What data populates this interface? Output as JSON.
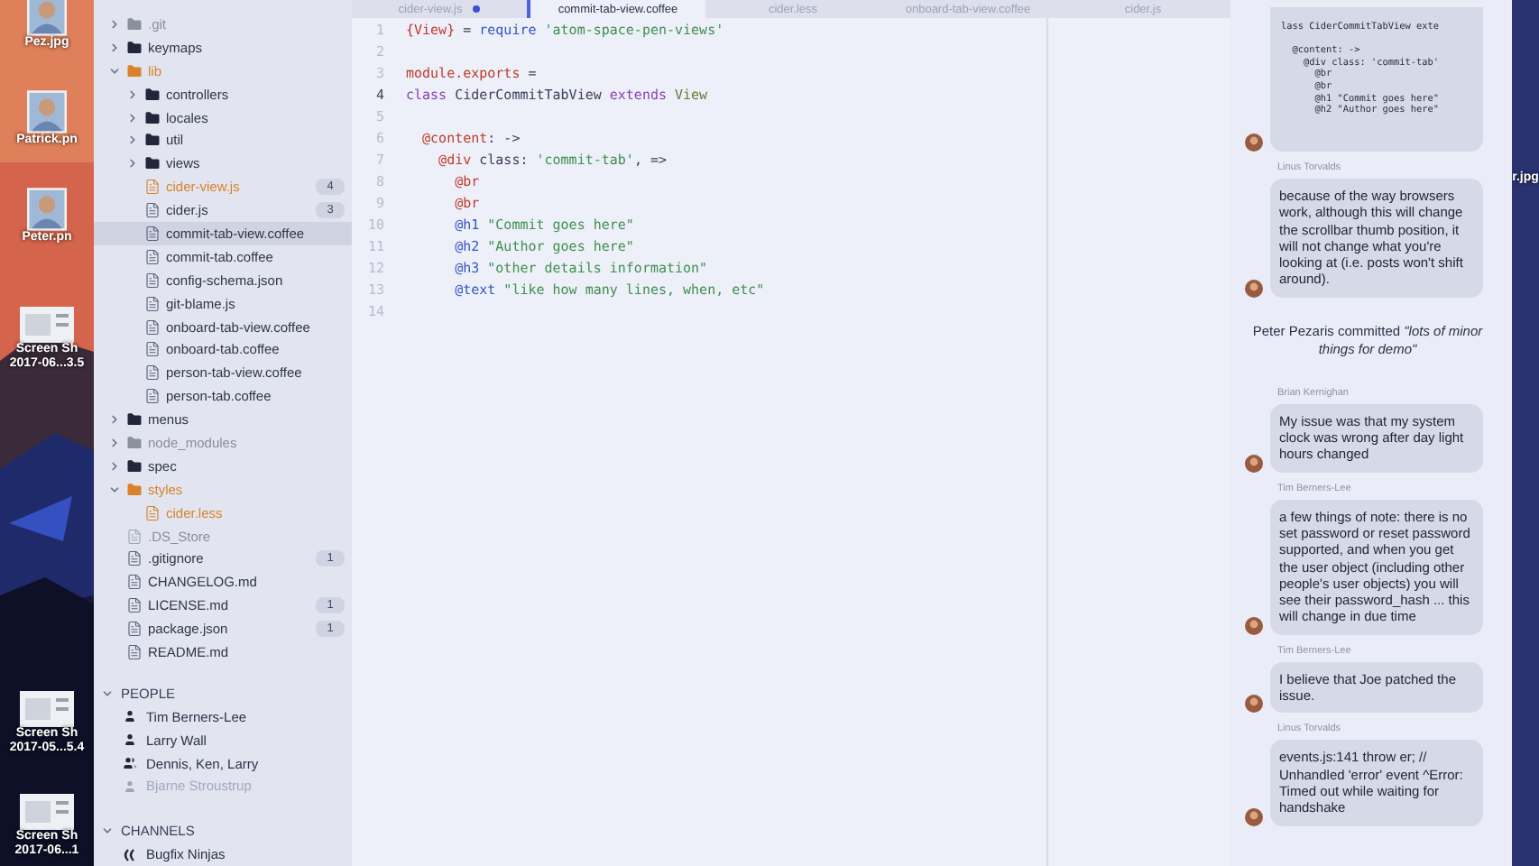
{
  "desktop_left": [
    {
      "lines": [
        "Pez.jpg"
      ]
    },
    {
      "lines": [
        "Patrick.pn"
      ]
    },
    {
      "lines": [
        "Peter.pn"
      ]
    },
    {
      "kind": "screenshot",
      "lines": [
        "Screen Sh",
        "2017-06...3.5"
      ]
    },
    {
      "kind": "screenshot",
      "lines": [
        "Screen Sh",
        "2017-05...5.4"
      ]
    },
    {
      "kind": "screenshot",
      "lines": [
        "Screen Sh",
        "2017-06...1"
      ]
    }
  ],
  "desktop_right": {
    "label": "r.jpg"
  },
  "tree": [
    {
      "name": ".git",
      "kind": "folder",
      "expanded": false,
      "modified": false,
      "ignored": true,
      "selected": false
    },
    {
      "name": "keymaps",
      "kind": "folder",
      "expanded": false,
      "modified": false,
      "ignored": false,
      "selected": false
    },
    {
      "name": "lib",
      "kind": "folder",
      "expanded": true,
      "modified": true,
      "ignored": false,
      "selected": false,
      "children": [
        {
          "name": "controllers",
          "kind": "folder",
          "expanded": false,
          "modified": false,
          "ignored": false,
          "selected": false
        },
        {
          "name": "locales",
          "kind": "folder",
          "expanded": false,
          "modified": false,
          "ignored": false,
          "selected": false
        },
        {
          "name": "util",
          "kind": "folder",
          "expanded": false,
          "modified": false,
          "ignored": false,
          "selected": false
        },
        {
          "name": "views",
          "kind": "folder",
          "expanded": false,
          "modified": false,
          "ignored": false,
          "selected": false
        },
        {
          "name": "cider-view.js",
          "kind": "file",
          "modified": true,
          "ignored": false,
          "badge": "4",
          "selected": false
        },
        {
          "name": "cider.js",
          "kind": "file",
          "modified": false,
          "ignored": false,
          "badge": "3",
          "selected": false
        },
        {
          "name": "commit-tab-view.coffee",
          "kind": "file",
          "modified": false,
          "ignored": false,
          "selected": true
        },
        {
          "name": "commit-tab.coffee",
          "kind": "file",
          "modified": false,
          "ignored": false,
          "selected": false
        },
        {
          "name": "config-schema.json",
          "kind": "file",
          "modified": false,
          "ignored": false,
          "selected": false
        },
        {
          "name": "git-blame.js",
          "kind": "file",
          "modified": false,
          "ignored": false,
          "selected": false
        },
        {
          "name": "onboard-tab-view.coffee",
          "kind": "file",
          "modified": false,
          "ignored": false,
          "selected": false
        },
        {
          "name": "onboard-tab.coffee",
          "kind": "file",
          "modified": false,
          "ignored": false,
          "selected": false
        },
        {
          "name": "person-tab-view.coffee",
          "kind": "file",
          "modified": false,
          "ignored": false,
          "selected": false
        },
        {
          "name": "person-tab.coffee",
          "kind": "file",
          "modified": false,
          "ignored": false,
          "selected": false
        }
      ]
    },
    {
      "name": "menus",
      "kind": "folder",
      "expanded": false,
      "modified": false,
      "ignored": false,
      "selected": false
    },
    {
      "name": "node_modules",
      "kind": "folder",
      "expanded": false,
      "modified": false,
      "ignored": true,
      "selected": false
    },
    {
      "name": "spec",
      "kind": "folder",
      "expanded": false,
      "modified": false,
      "ignored": false,
      "selected": false
    },
    {
      "name": "styles",
      "kind": "folder",
      "expanded": true,
      "modified": true,
      "ignored": false,
      "selected": false,
      "children": [
        {
          "name": "cider.less",
          "kind": "file",
          "modified": true,
          "ignored": false,
          "selected": false
        }
      ]
    },
    {
      "name": ".DS_Store",
      "kind": "file",
      "modified": false,
      "ignored": true,
      "selected": false
    },
    {
      "name": ".gitignore",
      "kind": "file",
      "modified": false,
      "ignored": false,
      "badge": "1",
      "selected": false
    },
    {
      "name": "CHANGELOG.md",
      "kind": "file",
      "modified": false,
      "ignored": false,
      "selected": false
    },
    {
      "name": "LICENSE.md",
      "kind": "file",
      "modified": false,
      "ignored": false,
      "badge": "1",
      "selected": false
    },
    {
      "name": "package.json",
      "kind": "file",
      "modified": false,
      "ignored": false,
      "badge": "1",
      "selected": false
    },
    {
      "name": "README.md",
      "kind": "file",
      "modified": false,
      "ignored": false,
      "selected": false
    }
  ],
  "people": {
    "title": "PEOPLE",
    "expanded": true,
    "items": [
      {
        "name": "Tim Berners-Lee",
        "kind": "person",
        "online": true
      },
      {
        "name": "Larry Wall",
        "kind": "person",
        "online": true
      },
      {
        "name": "Dennis, Ken, Larry",
        "kind": "group",
        "online": true
      },
      {
        "name": "Bjarne Stroustrup",
        "kind": "person",
        "online": false
      }
    ]
  },
  "channels": {
    "title": "CHANNELS",
    "expanded": true,
    "items": [
      {
        "name": "Bugfix Ninjas"
      }
    ]
  },
  "tabs": [
    {
      "label": "cider-view.js",
      "selected": false,
      "modified": true
    },
    {
      "label": "commit-tab-view.coffee",
      "selected": true,
      "modified": false
    },
    {
      "label": "cider.less",
      "selected": false,
      "modified": false
    },
    {
      "label": "onboard-tab-view.coffee",
      "selected": false,
      "modified": false
    },
    {
      "label": "cider.js",
      "selected": false,
      "modified": false
    }
  ],
  "code": [
    {
      "number": "1",
      "current": false,
      "tokens": [
        {
          "text": "{View}",
          "kind": "variable"
        },
        {
          "text": " = ",
          "kind": "plain"
        },
        {
          "text": "require",
          "kind": "builtin"
        },
        {
          "text": " 'atom-space-pen-views'",
          "kind": "string"
        }
      ]
    },
    {
      "number": "2",
      "current": false
    },
    {
      "number": "3",
      "current": false,
      "tokens": [
        {
          "text": "module.exports",
          "kind": "variable"
        },
        {
          "text": " =",
          "kind": "plain"
        }
      ]
    },
    {
      "number": "4",
      "current": true,
      "tokens": [
        {
          "text": "class",
          "kind": "keyword"
        },
        {
          "text": " CiderCommitTabView ",
          "kind": "plain"
        },
        {
          "text": "extends",
          "kind": "keyword"
        },
        {
          "text": " View",
          "kind": "class"
        }
      ]
    },
    {
      "number": "5",
      "current": false
    },
    {
      "number": "6",
      "current": false,
      "tokens": [
        {
          "text": "  @content",
          "kind": "variable"
        },
        {
          "text": ": ->",
          "kind": "plain"
        }
      ]
    },
    {
      "number": "7",
      "current": false,
      "tokens": [
        {
          "text": "    @div",
          "kind": "variable"
        },
        {
          "text": " class: ",
          "kind": "plain"
        },
        {
          "text": "'commit-tab'",
          "kind": "string"
        },
        {
          "text": ", =>",
          "kind": "plain"
        }
      ]
    },
    {
      "number": "8",
      "current": false,
      "tokens": [
        {
          "text": "      @br",
          "kind": "variable"
        }
      ]
    },
    {
      "number": "9",
      "current": false,
      "tokens": [
        {
          "text": "      @br",
          "kind": "variable"
        }
      ]
    },
    {
      "number": "10",
      "current": false,
      "tokens": [
        {
          "text": "      @h1",
          "kind": "builtin"
        },
        {
          "text": " \"Commit goes here\"",
          "kind": "string"
        }
      ]
    },
    {
      "number": "11",
      "current": false,
      "tokens": [
        {
          "text": "      @h2",
          "kind": "builtin"
        },
        {
          "text": " \"Author goes here\"",
          "kind": "string"
        }
      ]
    },
    {
      "number": "12",
      "current": false,
      "tokens": [
        {
          "text": "      @h3",
          "kind": "builtin"
        },
        {
          "text": " \"other details information\"",
          "kind": "string"
        }
      ]
    },
    {
      "number": "13",
      "current": false,
      "tokens": [
        {
          "text": "      @text",
          "kind": "builtin"
        },
        {
          "text": " \"like how many lines, when, etc\"",
          "kind": "string"
        }
      ]
    },
    {
      "number": "14",
      "current": false
    }
  ],
  "chat": [
    {
      "kind": "code",
      "lines": [
        "lass CiderCommitTabView exte",
        "  @content: ->",
        "    @div class: 'commit-tab'",
        "      @br",
        "      @br",
        "      @h1 \"Commit goes here\"",
        "      @h2 \"Author goes here\""
      ]
    },
    {
      "kind": "message",
      "author": "Linus Torvalds",
      "text": "because of the way browsers work, although this will change the scrollbar thumb position, it will not change what you're looking at (i.e. posts won't shift around)."
    },
    {
      "kind": "commit",
      "text": "Peter Pezaris committed *\"lots of minor things for demo\"*"
    },
    {
      "kind": "message",
      "author": "Brian Kernighan",
      "text": "My issue was that my system clock was wrong after day light hours changed"
    },
    {
      "kind": "message",
      "author": "Tim Berners-Lee",
      "text": "a few things of note: there is no set password or reset password supported, and when you get the user object (including other people's user objects) you will see their password_hash ... this will change in due time"
    },
    {
      "kind": "message",
      "author": "Tim Berners-Lee",
      "text": "I believe that Joe patched the issue."
    },
    {
      "kind": "message",
      "author": "Linus Torvalds",
      "text": "events.js:141 throw er; // Unhandled 'error' event ^Error: Timed out while waiting for handshake"
    }
  ]
}
